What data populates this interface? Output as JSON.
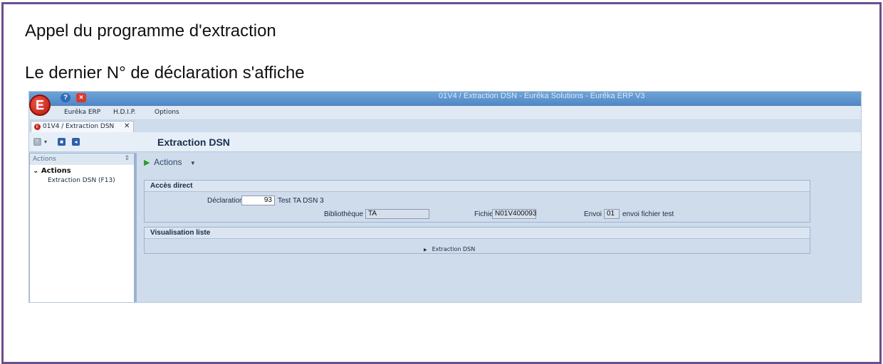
{
  "captions": {
    "line1": "Appel du programme d'extraction",
    "line2": "Le dernier N° de déclaration s'affiche"
  },
  "window": {
    "title": "01V4 / Extraction DSN - Eurêka Solutions - Eurêka ERP V3",
    "logo_letter": "E"
  },
  "menu": {
    "items": [
      "Eurêka ERP",
      "H.D.I.P.",
      "Options"
    ]
  },
  "tab": {
    "label": "01V4 / Extraction DSN",
    "close": "✕"
  },
  "screen": {
    "title": "Extraction DSN"
  },
  "sidebar": {
    "header": "Actions",
    "pin": "⇕",
    "group": "Actions",
    "group_toggle": "⌄",
    "items": [
      "Extraction DSN (F13)"
    ]
  },
  "actions_menu": {
    "label": "Actions"
  },
  "acces_direct": {
    "title": "Accès direct",
    "declaration_label": "Déclaration",
    "declaration_value": "93",
    "declaration_desc": "Test TA DSN 3",
    "bibliotheque_label": "Bibliothèque",
    "bibliotheque_value": "TA",
    "fichier_label": "Fichier",
    "fichier_value": "N01V400093",
    "envoi_label": "Envoi",
    "envoi_value": "01",
    "envoi_desc": "envoi fichier test"
  },
  "visualisation": {
    "title": "Visualisation liste",
    "item": "Extraction DSN"
  },
  "icons": [
    "logo-icon",
    "help-icon",
    "close-icon",
    "copy-icon",
    "save-icon",
    "back-icon",
    "pin-icon",
    "play-icon",
    "expand-icon"
  ]
}
